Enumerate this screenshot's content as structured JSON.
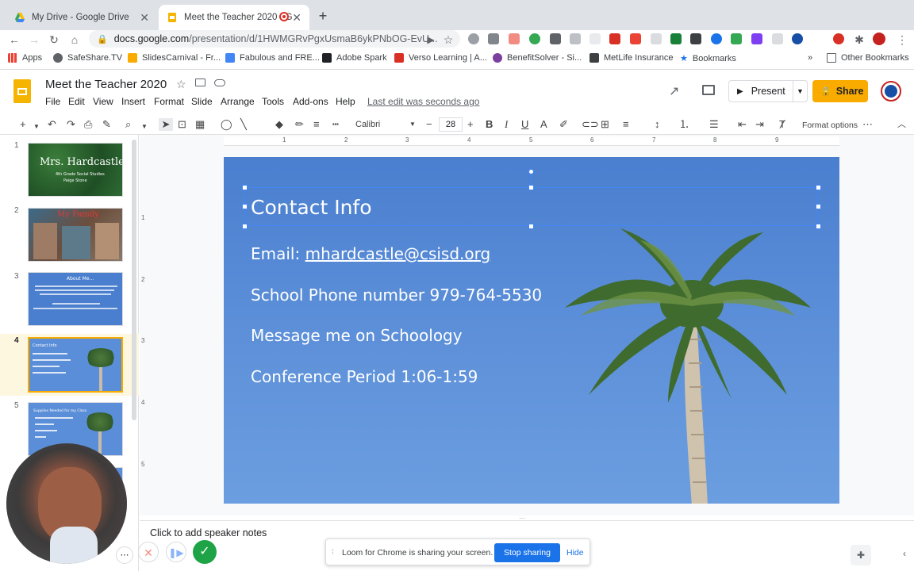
{
  "browser": {
    "tabs": [
      {
        "title": "My Drive - Google Drive",
        "active": false
      },
      {
        "title": "Meet the Teacher 2020 - G",
        "active": true
      }
    ],
    "url_host": "docs.google.com",
    "url_path": "/presentation/d/1HWMGRvPgxUsmaB6ykPNbOG-EvU...",
    "bookmarks": [
      "Apps",
      "SafeShare.TV",
      "SlidesCarnival - Fr...",
      "Fabulous and FRE...",
      "Adobe Spark",
      "Verso Learning | A...",
      "BenefitSolver - Si...",
      "MetLife Insurance",
      "Bookmarks"
    ],
    "other_bookmarks": "Other Bookmarks",
    "overflow": "»"
  },
  "doc": {
    "title": "Meet the Teacher 2020",
    "menus": [
      "File",
      "Edit",
      "View",
      "Insert",
      "Format",
      "Slide",
      "Arrange",
      "Tools",
      "Add-ons",
      "Help"
    ],
    "last_edit": "Last edit was seconds ago",
    "present_label": "Present",
    "share_label": "Share"
  },
  "toolbar": {
    "font": "Calibri",
    "font_size": "28",
    "format_options": "Format options"
  },
  "ruler": {
    "h_numbers": [
      "1",
      "2",
      "3",
      "4",
      "5",
      "6",
      "7",
      "8",
      "9"
    ],
    "v_numbers": [
      "1",
      "2",
      "3",
      "4",
      "5"
    ]
  },
  "slides": [
    {
      "num": "1",
      "title": "Mrs. Hardcastle",
      "subtitle": "4th Grade Social Studies",
      "subtitle2": "Paige Stone"
    },
    {
      "num": "2",
      "title": "My Family"
    },
    {
      "num": "3",
      "title": "About Me..."
    },
    {
      "num": "4",
      "title": "Contact Info"
    },
    {
      "num": "5",
      "title": "Supplies Needed for my Class"
    }
  ],
  "slide": {
    "title": "Contact Info",
    "email_label": "Email: ",
    "email": "mhardcastle@csisd.org",
    "phone": "School Phone number 979-764-5530",
    "message": "Message me on Schoology",
    "conference": "Conference Period 1:06-1:59"
  },
  "notes": {
    "placeholder": "Click to add speaker notes"
  },
  "loom": {
    "message": "Loom for Chrome is sharing your screen.",
    "stop": "Stop sharing",
    "hide": "Hide"
  },
  "colors": {
    "accent": "#f9ab00",
    "link": "#1a73e8",
    "slide_bg": "#5b8ed8"
  }
}
